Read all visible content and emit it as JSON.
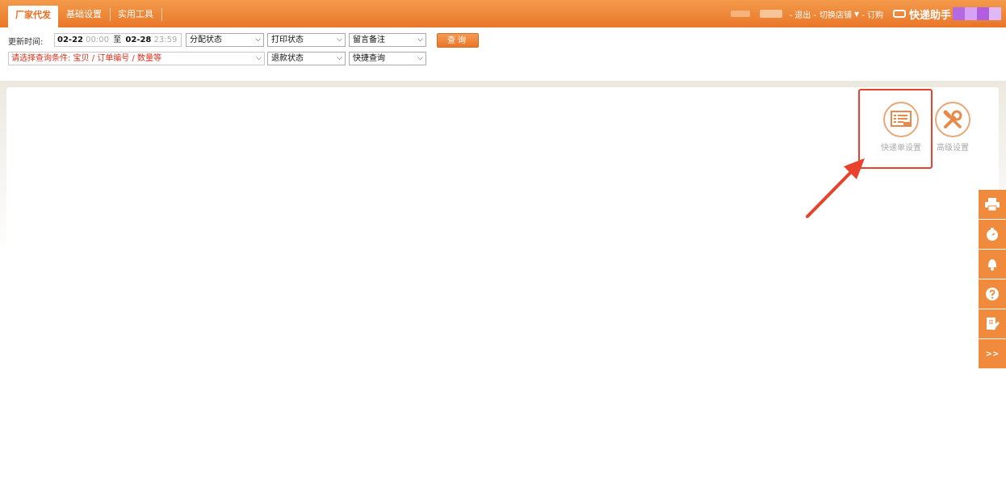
{
  "header": {
    "tabs": [
      {
        "label": "厂家代发",
        "active": true
      },
      {
        "label": "基础设置",
        "active": false
      },
      {
        "label": "实用工具",
        "active": false
      }
    ],
    "links": {
      "logout": "- 退出 -",
      "switch_store": "切换店铺",
      "order": "- 订购"
    },
    "brand": "快递助手"
  },
  "filter": {
    "update_time_label": "更新时间:",
    "date_from": "02-22",
    "time_from": "00:00",
    "to_label": "至",
    "date_to": "02-28",
    "time_to": "23:59",
    "selects": {
      "assign_status": "分配状态",
      "print_status": "打印状态",
      "message_note": "留言备注",
      "refund_status": "退款状态",
      "quick_query": "快捷查询"
    },
    "query_button": "查询",
    "condition": "请选择查询条件:  宝贝 / 订单编号 / 数量等"
  },
  "tools": [
    {
      "label": "快递单设置",
      "icon": "express-sheet-icon",
      "highlighted": true
    },
    {
      "label": "高级设置",
      "icon": "wrench-screwdriver-icon",
      "highlighted": false
    }
  ],
  "side_toolbar": {
    "items": [
      "printer-icon",
      "timer-icon",
      "notification-icon",
      "help-icon",
      "edit-note-icon"
    ],
    "expand_label": ">>"
  },
  "colors": {
    "accent": "#e9772a",
    "highlight": "#e8422d",
    "condition_text": "#d9301b"
  }
}
